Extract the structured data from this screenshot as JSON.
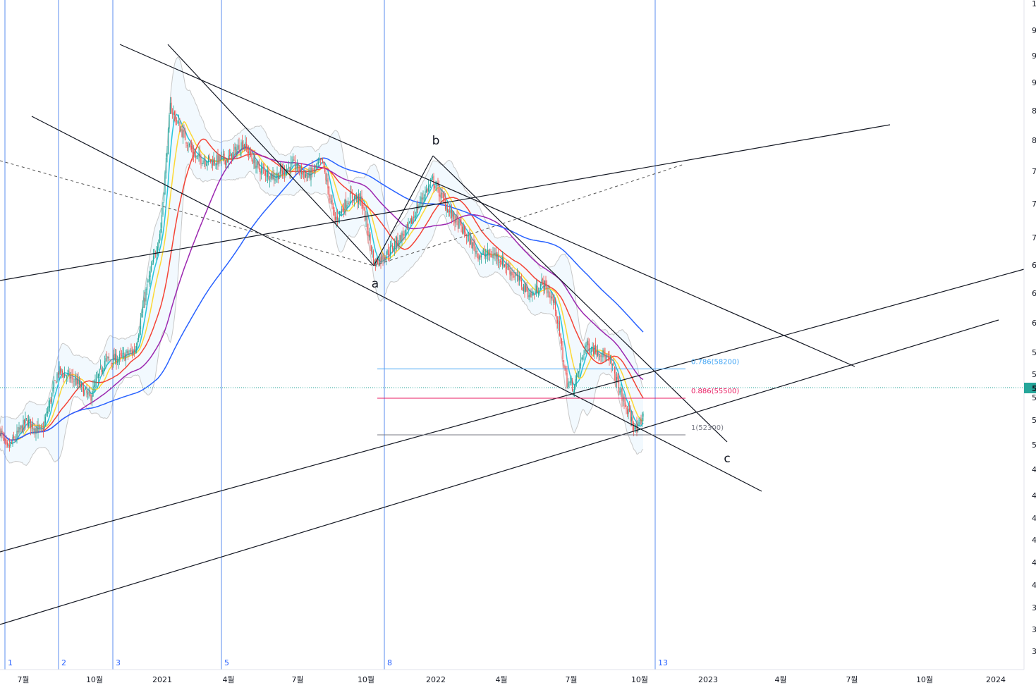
{
  "chart_data": {
    "type": "candlestick",
    "x_axis_labels": [
      "7월",
      "10월",
      "2021",
      "4월",
      "7월",
      "10월",
      "2022",
      "4월",
      "7월",
      "10월",
      "2023",
      "4월",
      "7월",
      "10월",
      "2024"
    ],
    "y_axis_tick_labels": [
      "1",
      "9",
      "9",
      "9",
      "8",
      "8",
      "7",
      "7",
      "7",
      "6",
      "6",
      "6",
      "5",
      "5",
      "5",
      "5",
      "5",
      "4",
      "4",
      "4",
      "4",
      "4",
      "4",
      "3",
      "3",
      "3"
    ],
    "current_price_label": "5",
    "wave_labels": [
      "a",
      "b",
      "c"
    ],
    "fib_levels": [
      {
        "ratio": 0.786,
        "value": 58200,
        "label": "0.786(58200)",
        "color": "#42a5f5"
      },
      {
        "ratio": 0.886,
        "value": 55500,
        "label": "0.886(55500)",
        "color": "#e91e63"
      },
      {
        "ratio": 1,
        "value": 52300,
        "label": "1(52300)",
        "color": "#787b86"
      }
    ],
    "cycle_markers": [
      "1",
      "2",
      "3",
      "5",
      "8",
      "13"
    ],
    "moving_average_colors": [
      "#26c6da",
      "#fdd835",
      "#f44336",
      "#9c27b0",
      "#2962ff"
    ],
    "candle_colors": {
      "up": "#26a69a",
      "down": "#ef5350"
    },
    "price_series": [
      [
        "2020-05-20",
        55000
      ],
      [
        "2020-06-10",
        51000
      ],
      [
        "2020-07-05",
        53500
      ],
      [
        "2020-07-25",
        52500
      ],
      [
        "2020-08-15",
        58000
      ],
      [
        "2020-09-05",
        57200
      ],
      [
        "2020-09-25",
        55500
      ],
      [
        "2020-10-15",
        59000
      ],
      [
        "2020-11-05",
        59200
      ],
      [
        "2020-11-25",
        60000
      ],
      [
        "2020-12-10",
        66000
      ],
      [
        "2020-12-30",
        73000
      ],
      [
        "2021-01-12",
        89000
      ],
      [
        "2021-01-25",
        86000
      ],
      [
        "2021-02-15",
        82000
      ],
      [
        "2021-03-10",
        81500
      ],
      [
        "2021-04-01",
        81800
      ],
      [
        "2021-04-20",
        84000
      ],
      [
        "2021-05-10",
        80500
      ],
      [
        "2021-06-01",
        79500
      ],
      [
        "2021-06-25",
        81000
      ],
      [
        "2021-07-15",
        79500
      ],
      [
        "2021-08-03",
        81500
      ],
      [
        "2021-08-20",
        74000
      ],
      [
        "2021-09-10",
        77000
      ],
      [
        "2021-09-25",
        76500
      ],
      [
        "2021-10-12",
        69000
      ],
      [
        "2021-11-01",
        70500
      ],
      [
        "2021-11-25",
        73000
      ],
      [
        "2021-12-15",
        77000
      ],
      [
        "2021-12-28",
        79000
      ],
      [
        "2022-01-20",
        75000
      ],
      [
        "2022-02-10",
        72500
      ],
      [
        "2022-03-01",
        70000
      ],
      [
        "2022-03-25",
        70000
      ],
      [
        "2022-04-15",
        68000
      ],
      [
        "2022-05-10",
        65500
      ],
      [
        "2022-05-25",
        67000
      ],
      [
        "2022-06-10",
        64500
      ],
      [
        "2022-06-25",
        57000
      ],
      [
        "2022-07-05",
        56500
      ],
      [
        "2022-07-20",
        60500
      ],
      [
        "2022-08-10",
        59800
      ],
      [
        "2022-08-25",
        58500
      ],
      [
        "2022-09-10",
        55000
      ],
      [
        "2022-09-28",
        52500
      ],
      [
        "2022-10-05",
        54000
      ],
      [
        "2022-10-09",
        56000
      ]
    ]
  }
}
